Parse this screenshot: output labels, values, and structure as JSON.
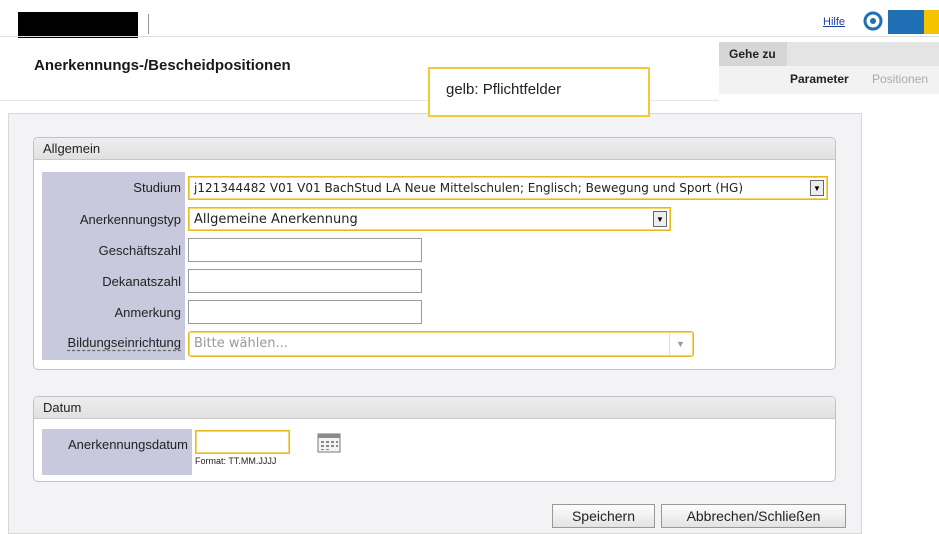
{
  "topbar": {
    "help": "Hilfe",
    "brand_colors": {
      "blue": "#1e6fb4",
      "yellow": "#f5c400"
    }
  },
  "header": {
    "title": "Anerkennungs-/Bescheidpositionen",
    "goto_label": "Gehe zu",
    "tabs": [
      "Parameter",
      "Positionen"
    ]
  },
  "note": "gelb: Pflichtfelder",
  "allgemein": {
    "legend": "Allgemein",
    "studium_label": "Studium",
    "studium_value": "j121344482 V01 V01 BachStud LA Neue Mittelschulen; Englisch; Bewegung und Sport (HG)",
    "typ_label": "Anerkennungstyp",
    "typ_value": "Allgemeine Anerkennung",
    "geschaeftszahl_label": "Geschäftszahl",
    "geschaeftszahl_value": "",
    "dekanatszahl_label": "Dekanatszahl",
    "dekanatszahl_value": "",
    "anmerkung_label": "Anmerkung",
    "anmerkung_value": "",
    "bildung_label": "Bildungseinrichtung",
    "bildung_placeholder": "Bitte wählen..."
  },
  "datum": {
    "legend": "Datum",
    "label": "Anerkennungsdatum",
    "value": "",
    "format_hint": "Format: TT.MM.JJJJ",
    "calendar_icon": "calendar-icon"
  },
  "buttons": {
    "save": "Speichern",
    "cancel": "Abbrechen/Schließen"
  },
  "colors": {
    "required_border": "#e8b824",
    "label_column": "#c9c9dd"
  }
}
